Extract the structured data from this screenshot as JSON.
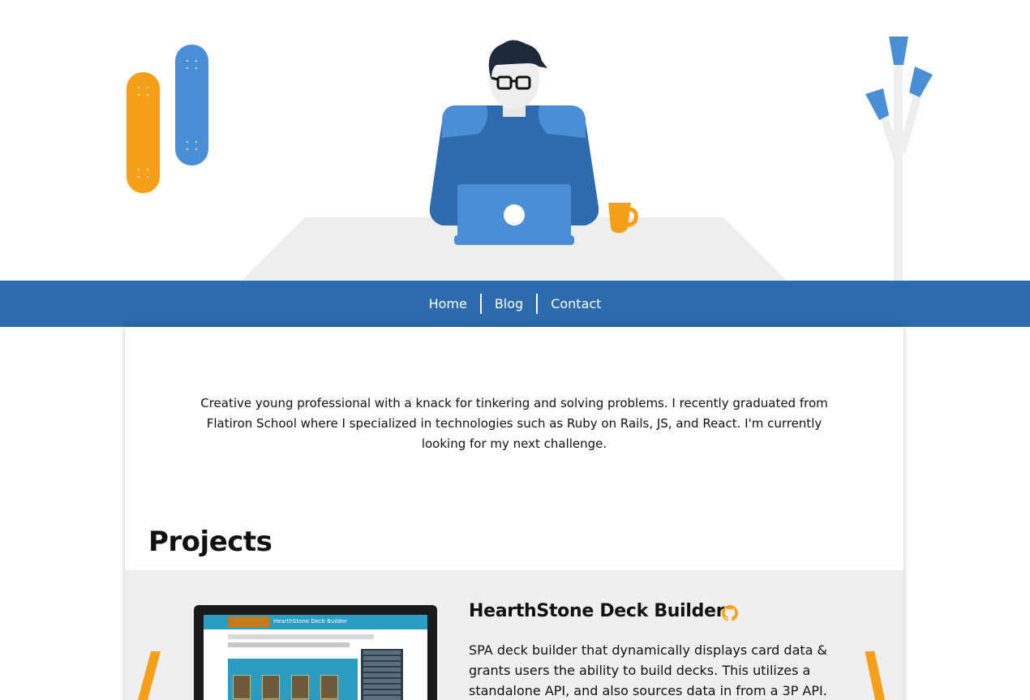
{
  "nav": {
    "items": [
      {
        "label": "Home"
      },
      {
        "label": "Blog"
      },
      {
        "label": "Contact"
      }
    ]
  },
  "intro": {
    "bio": "Creative young professional with a knack for tinkering and solving problems. I recently graduated from Flatiron School where I specialized in technologies such as Ruby on Rails, JS, and React. I'm currently looking for my next challenge."
  },
  "projects": {
    "heading": "Projects",
    "items": [
      {
        "title": "HearthStone Deck Builder",
        "description": "SPA deck builder that dynamically displays card data & grants users the ability to build decks. This utilizes a standalone API, and also sources data in from a 3P API.",
        "screenshot_header": "HearthStone Deck Builder",
        "link_icon": "github-icon"
      }
    ]
  },
  "colors": {
    "nav_bg": "#2d6aae",
    "accent_orange": "#f6a01a",
    "accent_blue": "#4a8fd6",
    "project_bg": "#efefef"
  }
}
